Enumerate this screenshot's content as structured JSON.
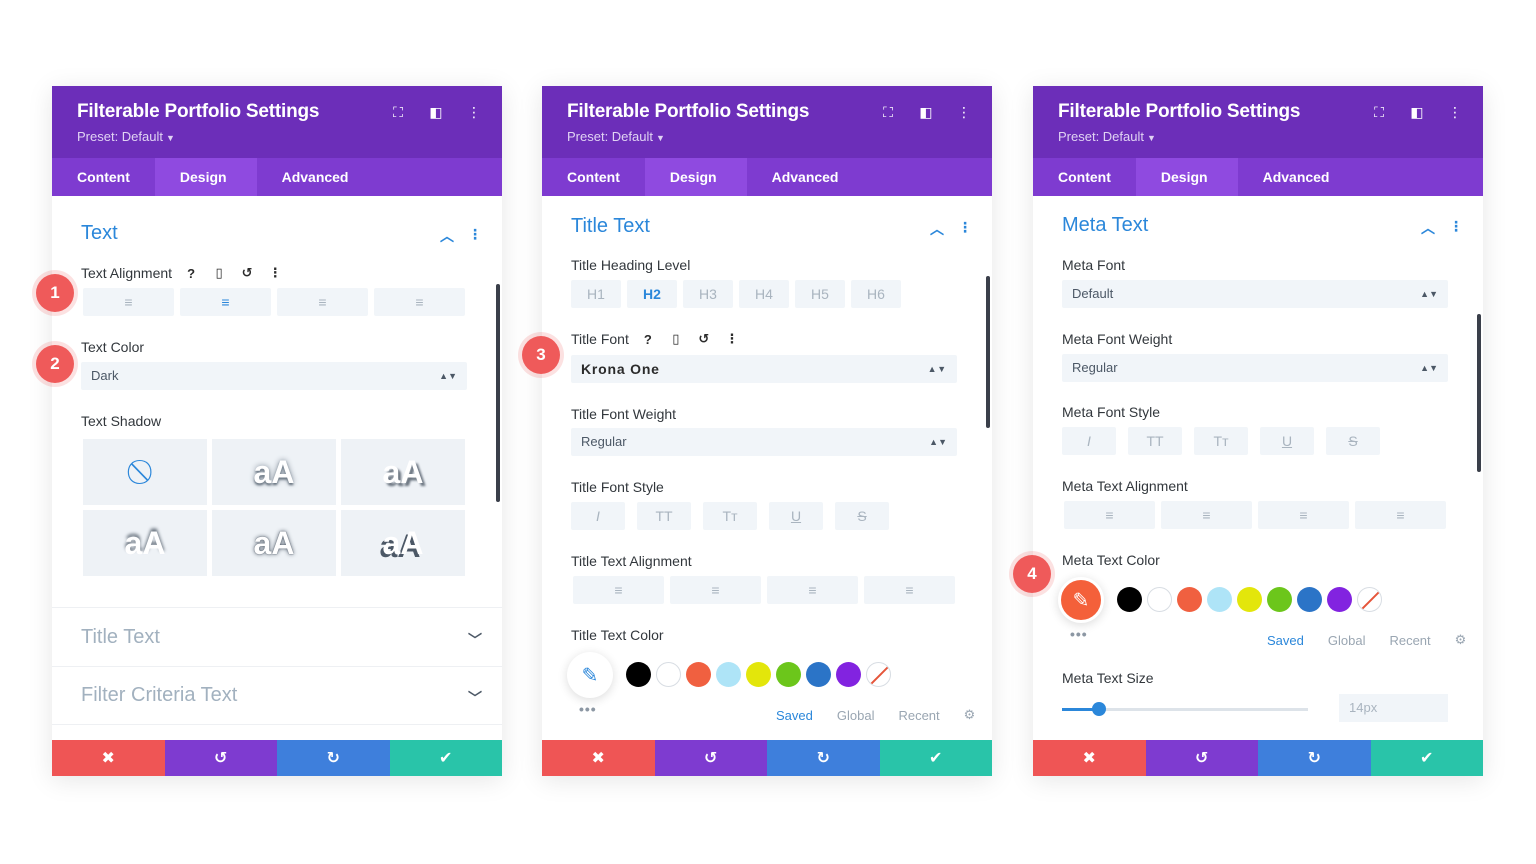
{
  "common": {
    "title": "Filterable Portfolio Settings",
    "preset": "Preset: Default",
    "tabs": [
      "Content",
      "Design",
      "Advanced"
    ]
  },
  "badges": [
    "1",
    "2",
    "3",
    "4"
  ],
  "panel1": {
    "section_title": "Text",
    "text_alignment_label": "Text Alignment",
    "text_color_label": "Text Color",
    "text_color_value": "Dark",
    "text_shadow_label": "Text Shadow",
    "shadow_sample": "aA",
    "collapsed_sections": [
      "Title Text",
      "Filter Criteria Text"
    ]
  },
  "panel2": {
    "section_title": "Title Text",
    "heading_level_label": "Title Heading Level",
    "heading_levels": [
      "H1",
      "H2",
      "H3",
      "H4",
      "H5",
      "H6"
    ],
    "heading_selected": "H2",
    "font_label": "Title Font",
    "font_value": "Krona One",
    "weight_label": "Title Font Weight",
    "weight_value": "Regular",
    "style_label": "Title Font Style",
    "alignment_label": "Title Text Alignment",
    "color_label": "Title Text Color"
  },
  "panel3": {
    "section_title": "Meta Text",
    "font_label": "Meta Font",
    "font_value": "Default",
    "weight_label": "Meta Font Weight",
    "weight_value": "Regular",
    "style_label": "Meta Font Style",
    "alignment_label": "Meta Text Alignment",
    "color_label": "Meta Text Color",
    "size_label": "Meta Text Size",
    "size_value": "14px",
    "size_slider_fraction": 0.15
  },
  "palette": {
    "tabs": [
      "Saved",
      "Global",
      "Recent"
    ],
    "colors": [
      "#000000",
      "#ffffff",
      "#f06040",
      "#aee4f7",
      "#e3e60b",
      "#6cc61b",
      "#2b74c7",
      "#8223e0"
    ],
    "dots": "•••"
  },
  "font_style_glyphs": [
    "I",
    "TT",
    "Tт",
    "U",
    "S"
  ],
  "icons": {
    "help": "?",
    "device": "▯",
    "reset": "↺",
    "more": "⋮"
  }
}
